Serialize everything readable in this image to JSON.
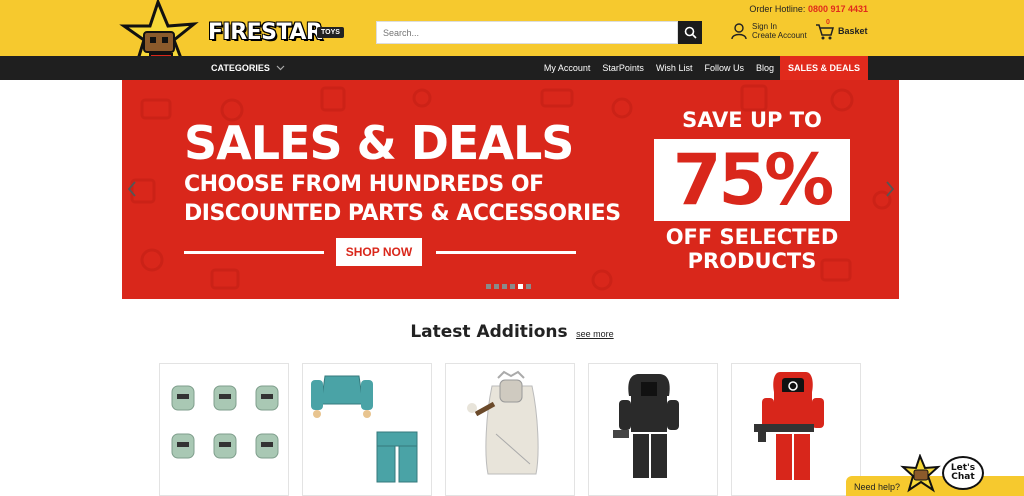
{
  "header": {
    "logo_text": "FIRESTAR",
    "logo_sub": "TOYS",
    "hotline_label": "Order Hotline:",
    "hotline_number": "0800 917 4431",
    "search_placeholder": "Search...",
    "sign_in": "Sign In",
    "create_account": "Create Account",
    "basket_label": "Basket",
    "basket_count": "0"
  },
  "nav": {
    "categories": "CATEGORIES",
    "links": [
      "My Account",
      "StarPoints",
      "Wish List",
      "Follow Us",
      "Blog",
      "SALES & DEALS"
    ]
  },
  "banner": {
    "title": "SALES & DEALS",
    "subtitle_line1": "CHOOSE FROM HUNDREDS OF",
    "subtitle_line2": "DISCOUNTED PARTS & ACCESSORIES",
    "button": "SHOP NOW",
    "save_up": "SAVE UP TO",
    "percent": "75%",
    "off_line1": "OFF SELECTED",
    "off_line2": "PRODUCTS",
    "slide_count": 6,
    "active_slide": 4
  },
  "latest": {
    "title": "Latest Additions",
    "see_more": "see more"
  },
  "products": [
    {
      "name": "zombie-heads",
      "color": "#a9c8b4"
    },
    {
      "name": "teal-torso-legs",
      "color": "#4aa3a6"
    },
    {
      "name": "bride-figure",
      "color": "#d6d2c8"
    },
    {
      "name": "black-figure",
      "color": "#2a2a2a"
    },
    {
      "name": "red-guard-figure",
      "color": "#d8261b"
    }
  ],
  "chat": {
    "help": "Need help?",
    "bubble_line1": "Let's",
    "bubble_line2": "Chat"
  },
  "colors": {
    "brand_yellow": "#f6c92e",
    "brand_red": "#d9271b",
    "nav_dark": "#1f1f1f"
  }
}
